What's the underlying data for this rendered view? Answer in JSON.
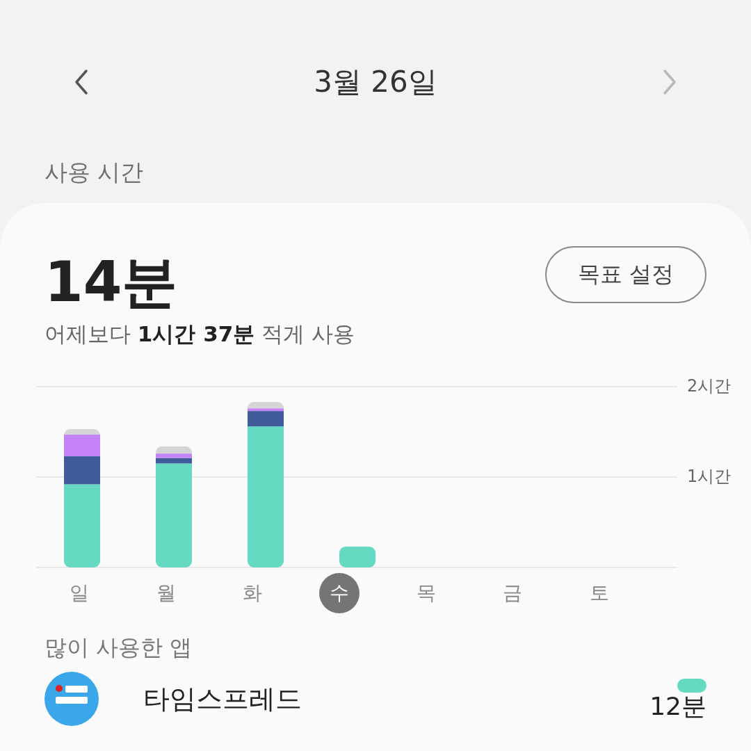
{
  "header": {
    "title": "3월 26일",
    "next_disabled": true
  },
  "section_title": "사용 시간",
  "summary": {
    "total": "14분",
    "comparison": "어제보다 **1시간 37분** 적게 사용",
    "goal_button": "목표 설정"
  },
  "chart": {
    "days": [
      {
        "selected": false
      },
      {
        "selected": false
      },
      {
        "selected": false
      },
      {
        "selected": true
      },
      {
        "selected": false
      },
      {
        "selected": false
      },
      {
        "selected": false
      }
    ],
    "chart_data": {
      "type": "bar",
      "stacked": true,
      "categories": [
        "일",
        "월",
        "화",
        "수",
        "목",
        "금",
        "토"
      ],
      "ylim": [
        0,
        2
      ],
      "yticks": [
        {
          "value": 1,
          "label": "1시간"
        },
        {
          "value": 2,
          "label": "2시간"
        }
      ],
      "series": [
        {
          "color": "#66d9c2",
          "values": [
            0.92,
            1.15,
            1.56,
            0.23,
            null,
            null,
            null
          ]
        },
        {
          "color": "#3f5b9a",
          "values": [
            0.31,
            0.06,
            0.17,
            null,
            null,
            null,
            null
          ]
        },
        {
          "color": "#c583f8",
          "values": [
            0.24,
            0.05,
            0.03,
            null,
            null,
            null,
            null
          ]
        },
        {
          "color": "#d5d5d5",
          "values": [
            0.06,
            0.08,
            0.07,
            null,
            null,
            null,
            null
          ]
        }
      ]
    }
  },
  "top_apps": {
    "title": "많이 사용한 앱",
    "apps": [
      {
        "name": "타임스프레드",
        "time": "12분"
      }
    ]
  }
}
